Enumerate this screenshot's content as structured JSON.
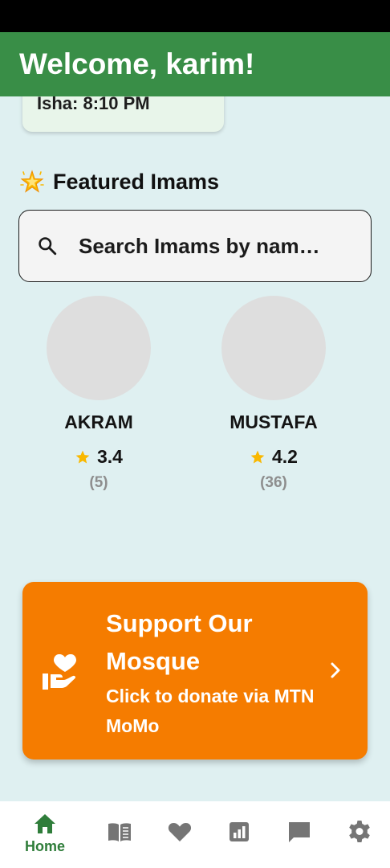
{
  "header": {
    "title": "Welcome, karim!"
  },
  "prayer_times": {
    "visible_entry": "Isha: 8:10 PM"
  },
  "featured": {
    "icon": "glowing-star-icon",
    "title": "Featured Imams",
    "search": {
      "placeholder": "Search Imams by nam…"
    },
    "imams": [
      {
        "name": "AKRAM",
        "rating": "3.4",
        "count": "(5)"
      },
      {
        "name": "MUSTAFA",
        "rating": "4.2",
        "count": "(36)"
      }
    ]
  },
  "donate": {
    "title": "Support Our Mosque",
    "subtitle": "Click to donate via MTN MoMo",
    "icon": "hand-heart-icon"
  },
  "bottom_nav": {
    "items": [
      {
        "label": "Home",
        "icon": "home-icon",
        "active": true
      },
      {
        "label": "",
        "icon": "book-icon",
        "active": false
      },
      {
        "label": "",
        "icon": "heart-icon",
        "active": false
      },
      {
        "label": "",
        "icon": "chart-icon",
        "active": false
      },
      {
        "label": "",
        "icon": "chat-icon",
        "active": false
      },
      {
        "label": "",
        "icon": "settings-icon",
        "active": false
      }
    ]
  },
  "colors": {
    "primary_green": "#398e47",
    "background": "#dff0f1",
    "donate_orange": "#f57c00",
    "star_yellow": "#f9b800",
    "nav_inactive": "#757575"
  }
}
